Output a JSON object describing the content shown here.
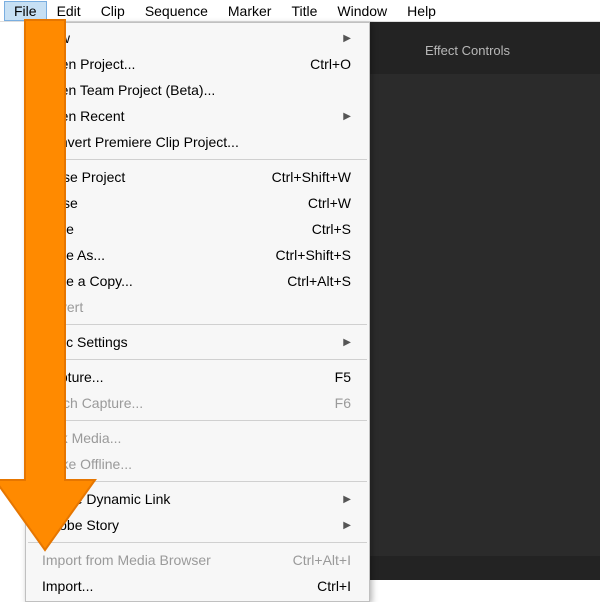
{
  "menubar": {
    "items": [
      {
        "label": "File",
        "active": true
      },
      {
        "label": "Edit"
      },
      {
        "label": "Clip"
      },
      {
        "label": "Sequence"
      },
      {
        "label": "Marker"
      },
      {
        "label": "Title"
      },
      {
        "label": "Window"
      },
      {
        "label": "Help"
      }
    ]
  },
  "file_menu": {
    "groups": [
      [
        {
          "label": "New",
          "submenu": true
        },
        {
          "label": "Open Project...",
          "shortcut": "Ctrl+O"
        },
        {
          "label": "Open Team Project (Beta)..."
        },
        {
          "label": "Open Recent",
          "submenu": true
        },
        {
          "label": "Convert Premiere Clip Project..."
        }
      ],
      [
        {
          "label": "Close Project",
          "shortcut": "Ctrl+Shift+W"
        },
        {
          "label": "Close",
          "shortcut": "Ctrl+W"
        },
        {
          "label": "Save",
          "shortcut": "Ctrl+S"
        },
        {
          "label": "Save As...",
          "shortcut": "Ctrl+Shift+S"
        },
        {
          "label": "Save a Copy...",
          "shortcut": "Ctrl+Alt+S"
        },
        {
          "label": "Revert",
          "disabled": true
        }
      ],
      [
        {
          "label": "Sync Settings",
          "submenu": true
        }
      ],
      [
        {
          "label": "Capture...",
          "shortcut": "F5"
        },
        {
          "label": "Batch Capture...",
          "shortcut": "F6",
          "disabled": true
        }
      ],
      [
        {
          "label": "Link Media...",
          "disabled": true
        },
        {
          "label": "Make Offline...",
          "disabled": true
        }
      ],
      [
        {
          "label": "Adobe Dynamic Link",
          "submenu": true
        },
        {
          "label": "Adobe Story",
          "submenu": true
        }
      ],
      [
        {
          "label": "Import from Media Browser",
          "shortcut": "Ctrl+Alt+I",
          "disabled": true
        },
        {
          "label": "Import...",
          "shortcut": "Ctrl+I"
        }
      ]
    ]
  },
  "panel": {
    "tab_label": "Effect Controls"
  },
  "annotation": {
    "arrow_color": "#ff8a00"
  }
}
